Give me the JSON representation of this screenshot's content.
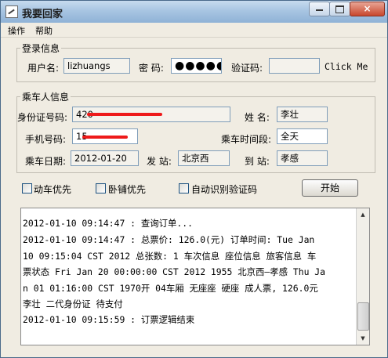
{
  "window": {
    "title": "我要回家",
    "controls": {
      "minimize": "min-icon",
      "maximize": "max-icon",
      "close": "×"
    }
  },
  "menu": [
    "操作",
    "帮助"
  ],
  "login": {
    "group_title": "登录信息",
    "username_label": "用户名:",
    "username_value": "lizhuangs",
    "password_label": "密 码:",
    "password_value": "●●●●●",
    "captcha_label": "验证码:",
    "captcha_value": "",
    "click_me": "Click Me"
  },
  "passenger": {
    "group_title": "乘车人信息",
    "id_label": "身份证号码:",
    "id_value": "420",
    "name_label": "姓 名:",
    "name_value": "李壮",
    "phone_label": "手机号码:",
    "phone_value": "15",
    "time_label": "乘车时间段:",
    "time_value": "全天",
    "date_label": "乘车日期:",
    "date_value": "2012-01-20",
    "from_label": "发 站:",
    "from_value": "北京西",
    "to_label": "到 站:",
    "to_value": "孝感",
    "redaction_color": "#ee1a1a"
  },
  "options": {
    "emu_priority": "动车优先",
    "sleeper_priority": "卧铺优先",
    "auto_captcha": "自动识别验证码",
    "start_button": "开始"
  },
  "log": [
    "2012-01-10 09:14:47 : 查询订单...",
    "2012-01-10 09:14:47 :  总票价: 126.0(元) 订单时间:  Tue Jan",
    "10 09:15:04 CST 2012 总张数: 1 车次信息 座位信息 旅客信息 车",
    "票状态 Fri Jan 20 00:00:00 CST 2012 1955 北京西—孝感 Thu Ja",
    "n 01 01:16:00 CST 1970开 04车厢 无座座 硬座 成人票, 126.0元",
    "李壮 二代身份证 待支付",
    "2012-01-10 09:15:59 : 订票逻辑结束"
  ]
}
